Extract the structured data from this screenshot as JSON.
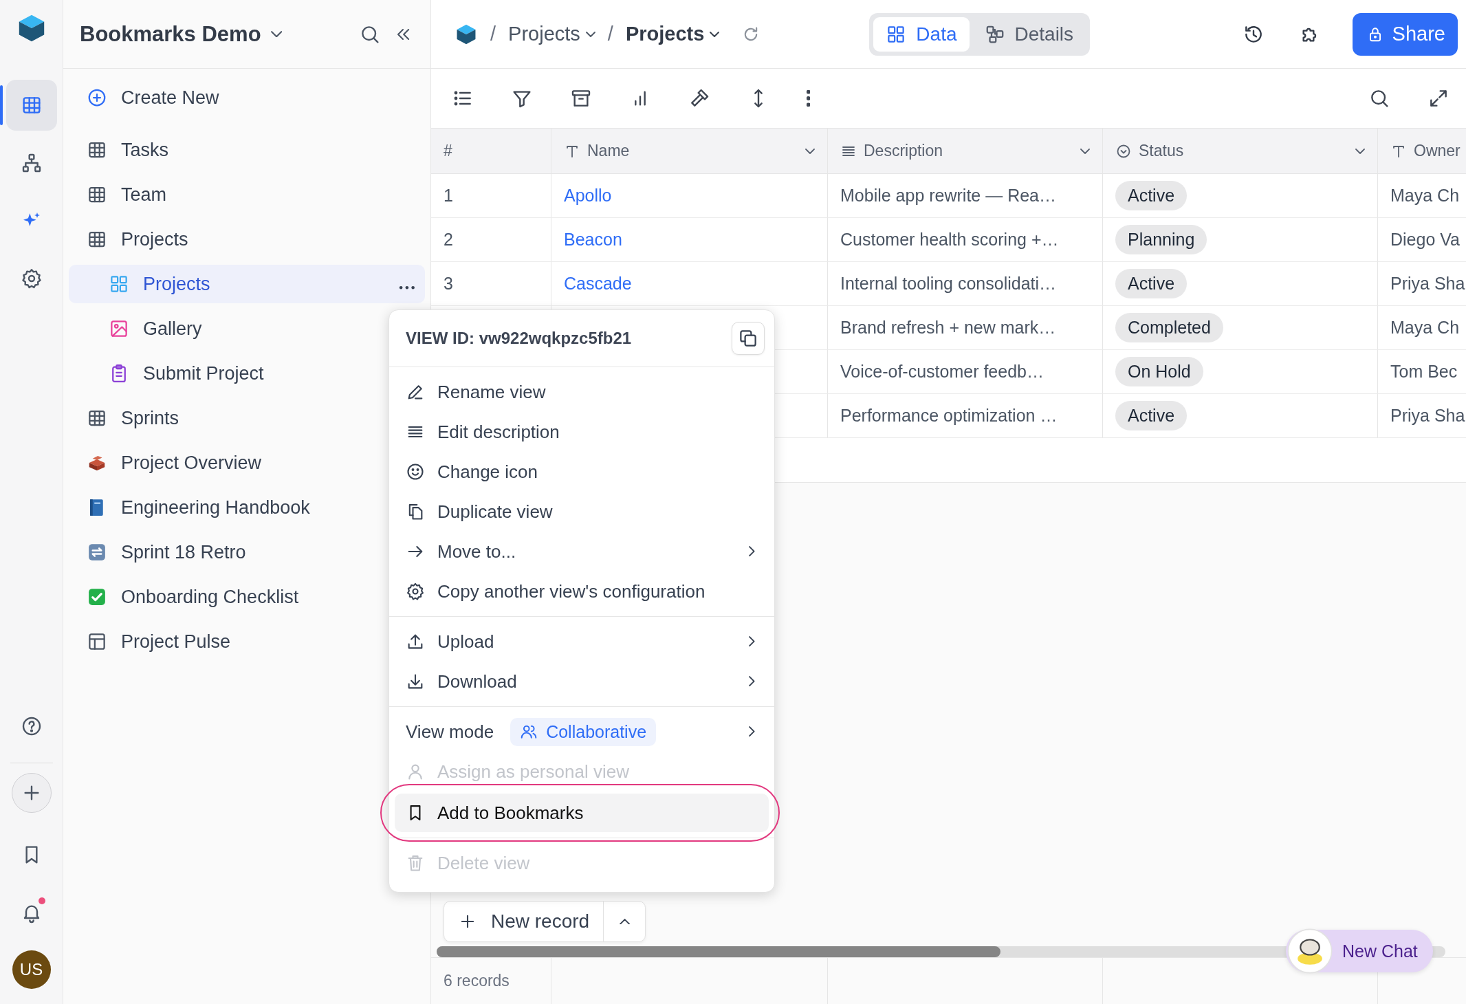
{
  "rail": {
    "items": [
      {
        "kind": "grid",
        "selected": true
      },
      {
        "kind": "hierarchy",
        "selected": false
      },
      {
        "kind": "sparkles",
        "selected": false
      },
      {
        "kind": "settings",
        "selected": false
      }
    ],
    "bottom": [
      {
        "kind": "help"
      },
      {
        "kind": "add"
      },
      {
        "kind": "bookmark"
      },
      {
        "kind": "bell",
        "badge": true
      }
    ],
    "avatar": "US"
  },
  "sidebar": {
    "title": "Bookmarks Demo",
    "create": "Create New",
    "items": [
      {
        "label": "Tasks",
        "kind": "table",
        "selected": false
      },
      {
        "label": "Team",
        "kind": "table",
        "selected": false
      },
      {
        "label": "Projects",
        "kind": "table",
        "selected": false,
        "children": [
          {
            "label": "Projects",
            "kind": "grid-view",
            "selected": true
          },
          {
            "label": "Gallery",
            "kind": "gallery-view",
            "selected": false
          },
          {
            "label": "Submit Project",
            "kind": "form-view",
            "selected": false
          }
        ]
      },
      {
        "label": "Sprints",
        "kind": "table",
        "selected": false
      },
      {
        "label": "Project Overview",
        "kind": "bricks-page",
        "selected": false
      },
      {
        "label": "Engineering Handbook",
        "kind": "book-page",
        "selected": false
      },
      {
        "label": "Sprint 18 Retro",
        "kind": "cycle-page",
        "selected": false
      },
      {
        "label": "Onboarding Checklist",
        "kind": "check-page",
        "selected": false
      },
      {
        "label": "Project Pulse",
        "kind": "dashboard",
        "selected": false
      }
    ]
  },
  "header": {
    "breadcrumb": [
      {
        "separator": "/",
        "label": "Projects",
        "current": false
      },
      {
        "separator": "/",
        "label": "Projects",
        "current": true
      }
    ],
    "tabs": [
      {
        "label": "Data",
        "kind": "data",
        "selected": true
      },
      {
        "label": "Details",
        "kind": "details",
        "selected": false
      }
    ],
    "share": "Share"
  },
  "table": {
    "columns": [
      {
        "label": "#",
        "kind": "index"
      },
      {
        "label": "Name",
        "kind": "text"
      },
      {
        "label": "Description",
        "kind": "longtext"
      },
      {
        "label": "Status",
        "kind": "status"
      },
      {
        "label": "Owner",
        "kind": "text"
      }
    ],
    "rows": [
      {
        "index": "1",
        "name": "Apollo",
        "description": "Mobile app rewrite — Rea…",
        "status": "Active",
        "owner": "Maya Ch"
      },
      {
        "index": "2",
        "name": "Beacon",
        "description": "Customer health scoring +…",
        "status": "Planning",
        "owner": "Diego Va"
      },
      {
        "index": "3",
        "name": "Cascade",
        "description": "Internal tooling consolidati…",
        "status": "Active",
        "owner": "Priya Sha"
      },
      {
        "description": "Brand refresh + new mark…",
        "status": "Completed",
        "owner": "Maya Ch"
      },
      {
        "description": "Voice-of-customer feedb…",
        "status": "On Hold",
        "owner": "Tom Bec"
      },
      {
        "description": "Performance optimization …",
        "status": "Active",
        "owner": "Priya Sha"
      }
    ]
  },
  "menu": {
    "title": "VIEW ID: vw922wqkpzc5fb21",
    "groups": [
      [
        {
          "label": "Rename view",
          "kind": "rename",
          "submenu": false,
          "disabled": false,
          "highlighted": false
        },
        {
          "label": "Edit description",
          "kind": "describe",
          "submenu": false,
          "disabled": false,
          "highlighted": false
        },
        {
          "label": "Change icon",
          "kind": "icon",
          "submenu": false,
          "disabled": false,
          "highlighted": false
        },
        {
          "label": "Duplicate view",
          "kind": "duplicate",
          "submenu": false,
          "disabled": false,
          "highlighted": false
        },
        {
          "label": "Move to...",
          "kind": "move",
          "submenu": true,
          "disabled": false,
          "highlighted": false
        },
        {
          "label": "Copy another view's configuration",
          "kind": "configure",
          "submenu": false,
          "disabled": false,
          "highlighted": false
        }
      ],
      [
        {
          "label": "Upload",
          "kind": "upload",
          "submenu": true,
          "disabled": false,
          "highlighted": false
        },
        {
          "label": "Download",
          "kind": "download",
          "submenu": true,
          "disabled": false,
          "highlighted": false
        }
      ],
      [
        {
          "label": "View mode",
          "kind": "mode",
          "value": "Collaborative",
          "submenu": true,
          "disabled": false,
          "highlighted": false
        },
        {
          "label": "Assign as personal view",
          "kind": "assign",
          "submenu": false,
          "disabled": true,
          "highlighted": false
        },
        {
          "label": "Add to Bookmarks",
          "kind": "bookmark",
          "submenu": false,
          "disabled": false,
          "highlighted": true
        }
      ],
      [
        {
          "label": "Delete view",
          "kind": "delete",
          "submenu": false,
          "disabled": true,
          "highlighted": false
        }
      ]
    ]
  },
  "footer": {
    "new_record": "New record",
    "records": "6 records",
    "chat": "New Chat"
  }
}
